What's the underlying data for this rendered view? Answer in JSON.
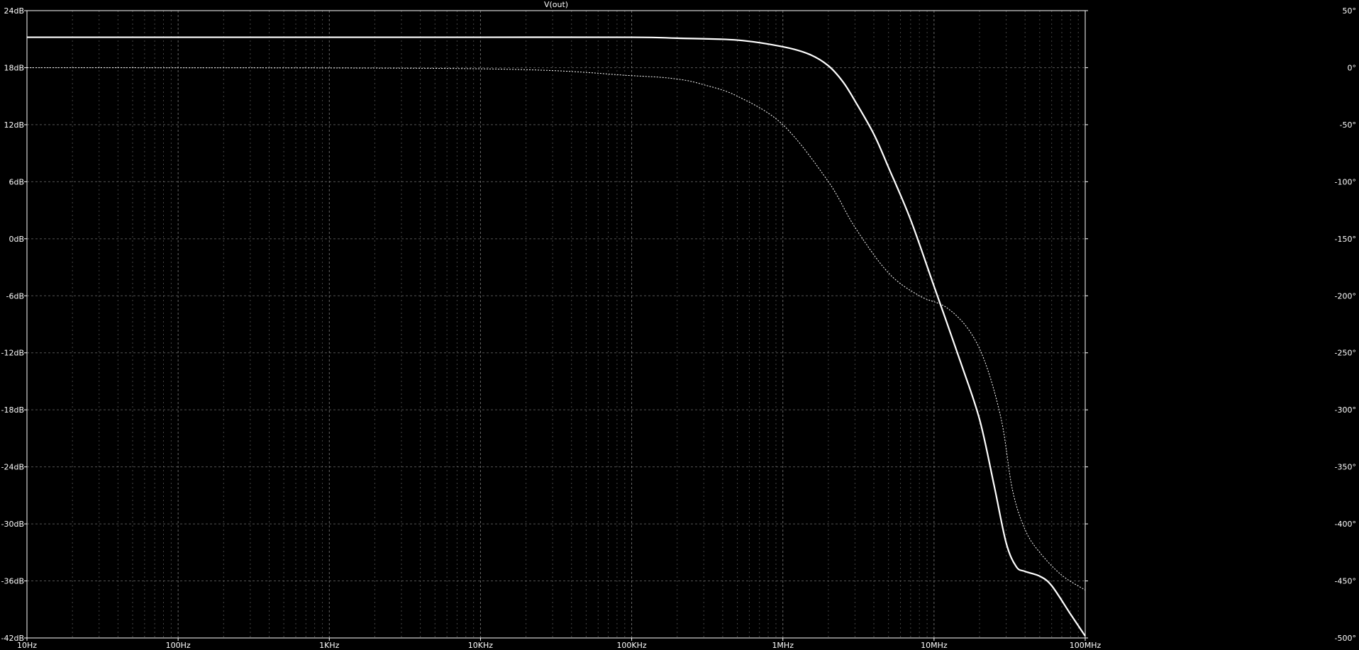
{
  "chart_data": {
    "type": "line",
    "title": "V(out)",
    "x_scale": "log",
    "xlim_hz": [
      10,
      100000000
    ],
    "x_ticks": [
      {
        "value": 10,
        "label": "10Hz"
      },
      {
        "value": 100,
        "label": "100Hz"
      },
      {
        "value": 1000,
        "label": "1KHz"
      },
      {
        "value": 10000,
        "label": "10KHz"
      },
      {
        "value": 100000,
        "label": "100KHz"
      },
      {
        "value": 1000000,
        "label": "1MHz"
      },
      {
        "value": 10000000,
        "label": "10MHz"
      },
      {
        "value": 100000000,
        "label": "100MHz"
      }
    ],
    "y_left": {
      "unit": "dB",
      "ylim": [
        -42,
        24
      ],
      "ticks": [
        {
          "value": 24,
          "label": "24dB"
        },
        {
          "value": 18,
          "label": "18dB"
        },
        {
          "value": 12,
          "label": "12dB"
        },
        {
          "value": 6,
          "label": "6dB"
        },
        {
          "value": 0,
          "label": "0dB"
        },
        {
          "value": -6,
          "label": "-6dB"
        },
        {
          "value": -12,
          "label": "-12dB"
        },
        {
          "value": -18,
          "label": "-18dB"
        },
        {
          "value": -24,
          "label": "-24dB"
        },
        {
          "value": -30,
          "label": "-30dB"
        },
        {
          "value": -36,
          "label": "-36dB"
        },
        {
          "value": -42,
          "label": "-42dB"
        }
      ]
    },
    "y_right": {
      "unit": "degrees",
      "ylim": [
        -500,
        50
      ],
      "ticks": [
        {
          "value": 50,
          "label": "50°"
        },
        {
          "value": 0,
          "label": "0°"
        },
        {
          "value": -50,
          "label": "-50°"
        },
        {
          "value": -100,
          "label": "-100°"
        },
        {
          "value": -150,
          "label": "-150°"
        },
        {
          "value": -200,
          "label": "-200°"
        },
        {
          "value": -250,
          "label": "-250°"
        },
        {
          "value": -300,
          "label": "-300°"
        },
        {
          "value": -350,
          "label": "-350°"
        },
        {
          "value": -400,
          "label": "-400°"
        },
        {
          "value": -450,
          "label": "-450°"
        },
        {
          "value": -500,
          "label": "-500°"
        }
      ]
    },
    "grid": true,
    "series": [
      {
        "style": "solid",
        "axis": "left",
        "color": "#ffffff",
        "points": [
          [
            10,
            21.2
          ],
          [
            1000,
            21.2
          ],
          [
            10000,
            21.2
          ],
          [
            100000,
            21.2
          ],
          [
            200000,
            21.1
          ],
          [
            500000,
            20.9
          ],
          [
            1000000,
            20.2
          ],
          [
            1500000,
            19.4
          ],
          [
            2000000,
            18.2
          ],
          [
            2500000,
            16.5
          ],
          [
            3000000,
            14.5
          ],
          [
            4000000,
            11.0
          ],
          [
            5000000,
            7.5
          ],
          [
            7000000,
            2.0
          ],
          [
            10000000,
            -5.0
          ],
          [
            15000000,
            -13.0
          ],
          [
            20000000,
            -19.0
          ],
          [
            25000000,
            -26.0
          ],
          [
            30000000,
            -32.0
          ],
          [
            35000000,
            -34.5
          ],
          [
            40000000,
            -35.0
          ],
          [
            50000000,
            -35.5
          ],
          [
            60000000,
            -36.5
          ],
          [
            80000000,
            -39.5
          ],
          [
            100000000,
            -41.8
          ]
        ]
      },
      {
        "style": "dotted",
        "axis": "right",
        "color": "#ffffff",
        "points": [
          [
            10,
            0
          ],
          [
            10000,
            -1
          ],
          [
            100000,
            -7
          ],
          [
            200000,
            -10
          ],
          [
            300000,
            -15
          ],
          [
            500000,
            -25
          ],
          [
            1000000,
            -50
          ],
          [
            2000000,
            -100
          ],
          [
            3000000,
            -140
          ],
          [
            5000000,
            -180
          ],
          [
            8000000,
            -200
          ],
          [
            12000000,
            -210
          ],
          [
            17000000,
            -230
          ],
          [
            22000000,
            -260
          ],
          [
            28000000,
            -310
          ],
          [
            33000000,
            -370
          ],
          [
            40000000,
            -405
          ],
          [
            50000000,
            -425
          ],
          [
            70000000,
            -445
          ],
          [
            100000000,
            -458
          ]
        ]
      }
    ]
  }
}
